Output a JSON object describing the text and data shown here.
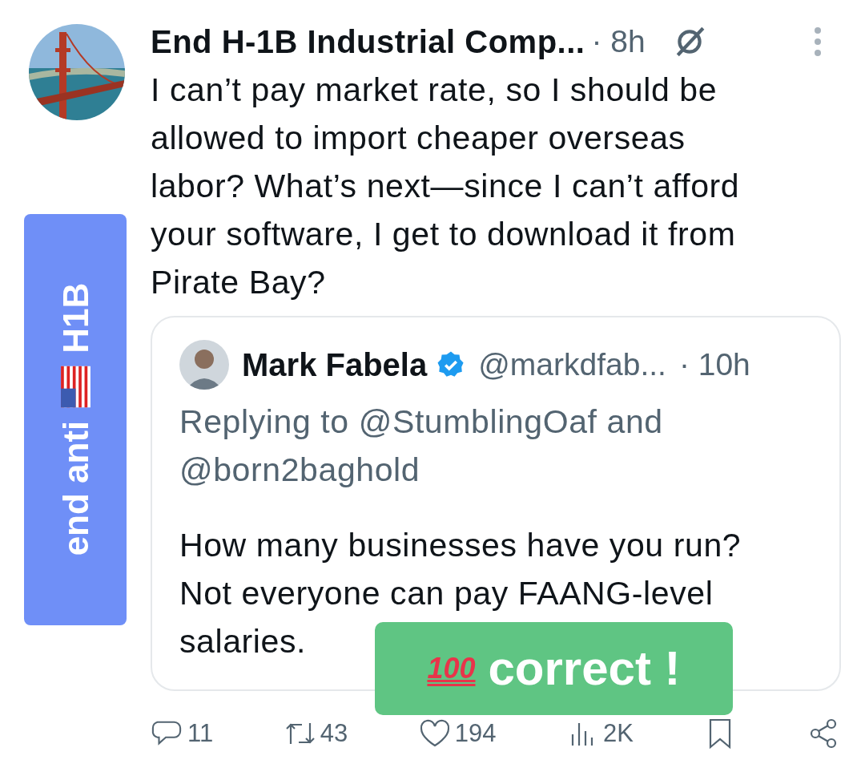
{
  "post": {
    "author": "End H-1B Industrial Comp...",
    "time": "· 8h",
    "text": "I can’t pay market rate, so I should be allowed to import cheaper overseas labor? What’s next—since I can’t afford your software, I get to download it from Pirate Bay?",
    "quote": {
      "author": "Mark Fabela",
      "verified": true,
      "handle": "@markdfab...",
      "time": "· 10h",
      "replying": "Replying to @StumblingOaf and @born2baghold",
      "text": "How many businesses have you run? Not everyone can pay FAANG-level salaries."
    },
    "actions": [
      {
        "kind": "reply",
        "count": "11"
      },
      {
        "kind": "repost",
        "count": "43"
      },
      {
        "kind": "like",
        "count": "194"
      },
      {
        "kind": "views",
        "count": "2K"
      },
      {
        "kind": "bookmark"
      },
      {
        "kind": "share"
      }
    ]
  },
  "stickers": [
    {
      "kind": "vertical",
      "color": "#6f8ff7",
      "before": "end anti",
      "after": "H1B"
    },
    {
      "kind": "horizontal",
      "color": "#5fc583",
      "emoji_text": "100",
      "text": "correct !"
    }
  ]
}
